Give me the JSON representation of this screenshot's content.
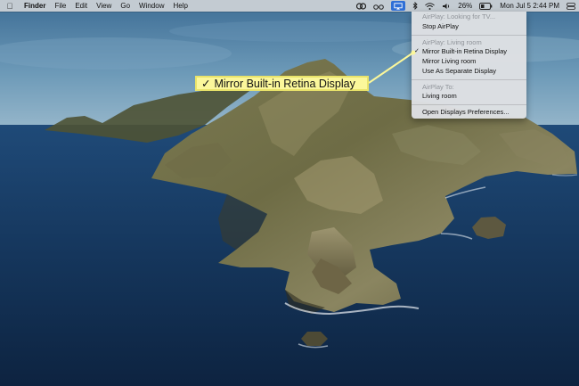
{
  "menubar": {
    "apple_icon": "apple-icon",
    "app_name": "Finder",
    "menus": [
      "File",
      "Edit",
      "View",
      "Go",
      "Window",
      "Help"
    ],
    "battery_percent": "26%",
    "datetime": "Mon Jul 5  2:44 PM"
  },
  "dropdown": {
    "header1": "AirPlay: Looking for TV...",
    "stop": "Stop AirPlay",
    "header2": "AirPlay: Living room",
    "mirror_builtin": "Mirror Built-in Retina Display",
    "mirror_living": "Mirror Living room",
    "separate": "Use As Separate Display",
    "header3": "AirPlay To:",
    "living_room": "Living room",
    "open_prefs": "Open Displays Preferences...",
    "check": "✓"
  },
  "callout": {
    "check": "✓",
    "text": "Mirror Built-in Retina Display",
    "color": "#fbf79b"
  },
  "colors": {
    "accent": "#2f6fd6",
    "highlight": "#fbf79b"
  }
}
